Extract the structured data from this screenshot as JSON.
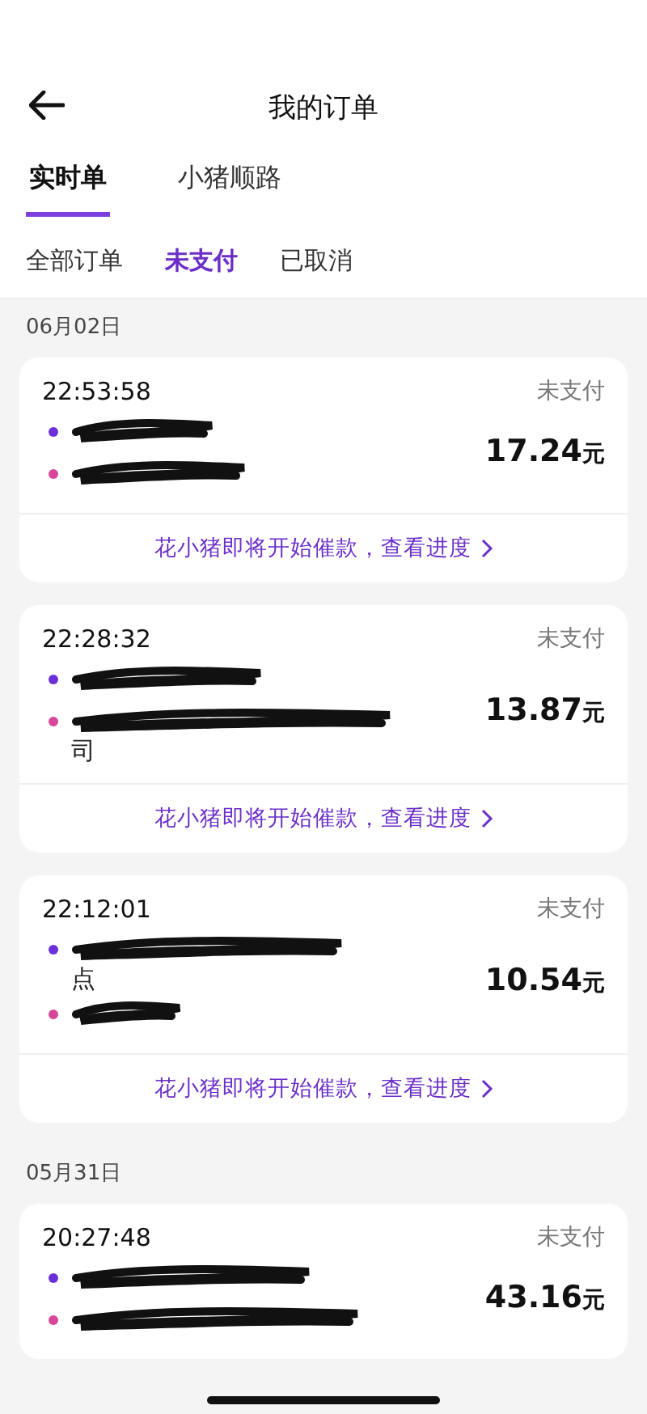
{
  "header": {
    "title": "我的订单"
  },
  "tabs": [
    {
      "label": "实时单",
      "selected": true
    },
    {
      "label": "小猪顺路",
      "selected": false
    }
  ],
  "filters": [
    {
      "label": "全部订单",
      "selected": false
    },
    {
      "label": "未支付",
      "selected": true
    },
    {
      "label": "已取消",
      "selected": false
    }
  ],
  "groups": [
    {
      "date": "06月02日",
      "orders": [
        {
          "time": "22:53:58",
          "status": "未支付",
          "amount": "17.24",
          "currency": "元",
          "stops": [
            {
              "kind": "pickup",
              "redacted": true
            },
            {
              "kind": "dropoff",
              "redacted": true
            }
          ],
          "footer": "花小猪即将开始催款，查看进度"
        },
        {
          "time": "22:28:32",
          "status": "未支付",
          "amount": "13.87",
          "currency": "元",
          "stops": [
            {
              "kind": "pickup",
              "redacted": true
            },
            {
              "kind": "dropoff",
              "redacted": true,
              "tail": "司"
            }
          ],
          "footer": "花小猪即将开始催款，查看进度"
        },
        {
          "time": "22:12:01",
          "status": "未支付",
          "amount": "10.54",
          "currency": "元",
          "stops": [
            {
              "kind": "pickup",
              "redacted": true,
              "tail": "点"
            },
            {
              "kind": "dropoff",
              "redacted": true
            }
          ],
          "footer": "花小猪即将开始催款，查看进度"
        }
      ]
    },
    {
      "date": "05月31日",
      "orders": [
        {
          "time": "20:27:48",
          "status": "未支付",
          "amount": "43.16",
          "currency": "元",
          "stops": [
            {
              "kind": "pickup",
              "redacted": true
            },
            {
              "kind": "dropoff",
              "redacted": true
            }
          ]
        }
      ]
    }
  ]
}
